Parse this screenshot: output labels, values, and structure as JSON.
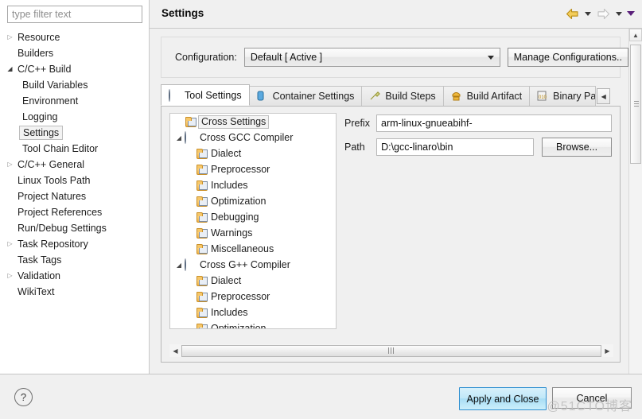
{
  "sidebar": {
    "filter_placeholder": "type filter text",
    "items": [
      {
        "label": "Resource",
        "twisty": "collapsed",
        "level": 1
      },
      {
        "label": "Builders",
        "twisty": "none",
        "level": 1
      },
      {
        "label": "C/C++ Build",
        "twisty": "expanded",
        "level": 1
      },
      {
        "label": "Build Variables",
        "twisty": "none",
        "level": 2
      },
      {
        "label": "Environment",
        "twisty": "none",
        "level": 2
      },
      {
        "label": "Logging",
        "twisty": "none",
        "level": 2
      },
      {
        "label": "Settings",
        "twisty": "none",
        "level": 2,
        "selected": true
      },
      {
        "label": "Tool Chain Editor",
        "twisty": "none",
        "level": 2
      },
      {
        "label": "C/C++ General",
        "twisty": "collapsed",
        "level": 1
      },
      {
        "label": "Linux Tools Path",
        "twisty": "none",
        "level": 1
      },
      {
        "label": "Project Natures",
        "twisty": "none",
        "level": 1
      },
      {
        "label": "Project References",
        "twisty": "none",
        "level": 1
      },
      {
        "label": "Run/Debug Settings",
        "twisty": "none",
        "level": 1
      },
      {
        "label": "Task Repository",
        "twisty": "collapsed",
        "level": 1
      },
      {
        "label": "Task Tags",
        "twisty": "none",
        "level": 1
      },
      {
        "label": "Validation",
        "twisty": "collapsed",
        "level": 1
      },
      {
        "label": "WikiText",
        "twisty": "none",
        "level": 1
      }
    ]
  },
  "header": {
    "title": "Settings",
    "back_icon": "back-arrow-icon",
    "forward_icon": "forward-arrow-icon",
    "menu_icon": "view-menu-icon"
  },
  "configuration": {
    "label": "Configuration:",
    "value": "Default  [ Active ]",
    "manage_button": "Manage Configurations.."
  },
  "tabs": [
    {
      "label": "Tool Settings",
      "icon": "gear-icon",
      "active": true
    },
    {
      "label": "Container Settings",
      "icon": "container-icon",
      "active": false
    },
    {
      "label": "Build Steps",
      "icon": "wrench-icon",
      "active": false
    },
    {
      "label": "Build Artifact",
      "icon": "artifact-icon",
      "active": false
    },
    {
      "label": "Binary Parse",
      "icon": "binary-icon",
      "active": false
    }
  ],
  "tab_scroll_left": "◀",
  "tool_tree": [
    {
      "label": "Cross Settings",
      "icon": "folder-icon",
      "level": 1,
      "twisty": "none",
      "selected": true
    },
    {
      "label": "Cross GCC Compiler",
      "icon": "gear-icon",
      "level": 1,
      "twisty": "expanded"
    },
    {
      "label": "Dialect",
      "icon": "folder-icon",
      "level": 2,
      "twisty": "none"
    },
    {
      "label": "Preprocessor",
      "icon": "folder-icon",
      "level": 2,
      "twisty": "none"
    },
    {
      "label": "Includes",
      "icon": "folder-icon",
      "level": 2,
      "twisty": "none"
    },
    {
      "label": "Optimization",
      "icon": "folder-icon",
      "level": 2,
      "twisty": "none"
    },
    {
      "label": "Debugging",
      "icon": "folder-icon",
      "level": 2,
      "twisty": "none"
    },
    {
      "label": "Warnings",
      "icon": "folder-icon",
      "level": 2,
      "twisty": "none"
    },
    {
      "label": "Miscellaneous",
      "icon": "folder-icon",
      "level": 2,
      "twisty": "none"
    },
    {
      "label": "Cross G++ Compiler",
      "icon": "gear-icon",
      "level": 1,
      "twisty": "expanded"
    },
    {
      "label": "Dialect",
      "icon": "folder-icon",
      "level": 2,
      "twisty": "none"
    },
    {
      "label": "Preprocessor",
      "icon": "folder-icon",
      "level": 2,
      "twisty": "none"
    },
    {
      "label": "Includes",
      "icon": "folder-icon",
      "level": 2,
      "twisty": "none"
    },
    {
      "label": "Optimization",
      "icon": "folder-icon",
      "level": 2,
      "twisty": "none"
    }
  ],
  "fields": {
    "prefix_label": "Prefix",
    "prefix_value": "arm-linux-gnueabihf-",
    "path_label": "Path",
    "path_value": "D:\\gcc-linaro\\bin",
    "browse_button": "Browse..."
  },
  "footer": {
    "help_icon": "?",
    "apply_button": "Apply and Close",
    "cancel_button": "Cancel",
    "watermark": "@51CTO博客"
  },
  "colors": {
    "dialog_bg": "#f0f0f0",
    "panel_white": "#ffffff",
    "default_button_accent": "#2f8fd0",
    "back_arrow": "#e8b319",
    "forward_arrow": "#c9c9c9",
    "menu_caret": "#5a1f7a"
  }
}
